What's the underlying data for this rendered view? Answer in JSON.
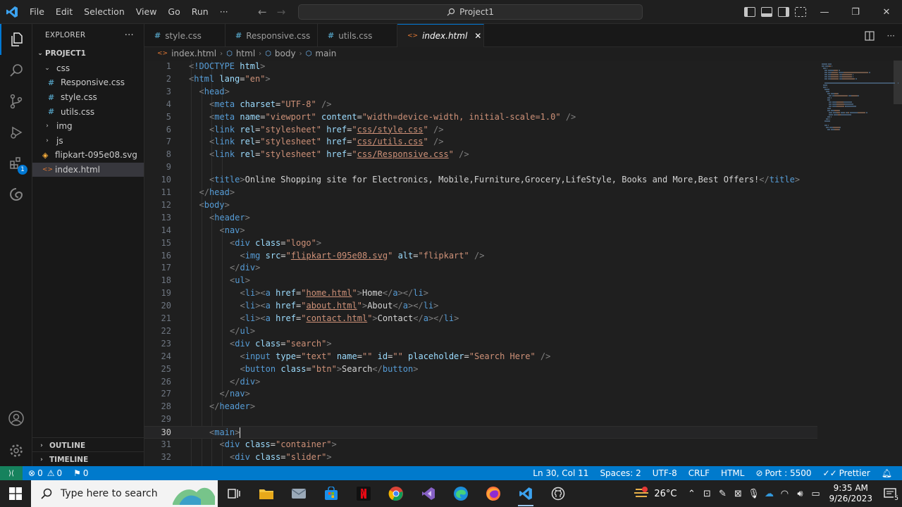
{
  "menu": [
    "File",
    "Edit",
    "Selection",
    "View",
    "Go",
    "Run",
    "···"
  ],
  "command_center": "Project1",
  "window_controls": {
    "minimize": "—",
    "restore": "❐",
    "close": "✕"
  },
  "explorer": {
    "title": "EXPLORER",
    "more": "···",
    "project": "PROJECT1",
    "tree": [
      {
        "label": "css",
        "kind": "folder-open",
        "depth": 1
      },
      {
        "label": "Responsive.css",
        "kind": "css",
        "depth": 2
      },
      {
        "label": "style.css",
        "kind": "css",
        "depth": 2
      },
      {
        "label": "utils.css",
        "kind": "css",
        "depth": 2
      },
      {
        "label": "img",
        "kind": "folder",
        "depth": 1
      },
      {
        "label": "js",
        "kind": "folder",
        "depth": 1
      },
      {
        "label": "flipkart-095e08.svg",
        "kind": "svg",
        "depth": 1
      },
      {
        "label": "index.html",
        "kind": "html",
        "depth": 1,
        "selected": true
      }
    ],
    "outline": "OUTLINE",
    "timeline": "TIMELINE"
  },
  "extensions_badge": "1",
  "tabs": [
    {
      "label": "style.css",
      "icon": "#"
    },
    {
      "label": "Responsive.css",
      "icon": "#"
    },
    {
      "label": "utils.css",
      "icon": "#"
    },
    {
      "label": "index.html",
      "icon": "<>",
      "active": true,
      "close": "✕"
    }
  ],
  "breadcrumb": [
    "index.html",
    "html",
    "body",
    "main"
  ],
  "code": [
    {
      "n": "1",
      "i": 0,
      "tokens": [
        [
          "ang",
          "<"
        ],
        [
          "tag",
          "!DOCTYPE"
        ],
        [
          "txt",
          " "
        ],
        [
          "attr",
          "html"
        ],
        [
          "ang",
          ">"
        ]
      ]
    },
    {
      "n": "2",
      "i": 0,
      "tokens": [
        [
          "ang",
          "<"
        ],
        [
          "tag",
          "html"
        ],
        [
          "txt",
          " "
        ],
        [
          "attr",
          "lang"
        ],
        [
          "txt",
          "="
        ],
        [
          "str",
          "\"en\""
        ],
        [
          "ang",
          ">"
        ]
      ]
    },
    {
      "n": "3",
      "i": 1,
      "tokens": [
        [
          "ang",
          "<"
        ],
        [
          "tag",
          "head"
        ],
        [
          "ang",
          ">"
        ]
      ]
    },
    {
      "n": "4",
      "i": 2,
      "tokens": [
        [
          "ang",
          "<"
        ],
        [
          "tag",
          "meta"
        ],
        [
          "txt",
          " "
        ],
        [
          "attr",
          "charset"
        ],
        [
          "txt",
          "="
        ],
        [
          "str",
          "\"UTF-8\""
        ],
        [
          "txt",
          " "
        ],
        [
          "ang",
          "/>"
        ]
      ]
    },
    {
      "n": "5",
      "i": 2,
      "tokens": [
        [
          "ang",
          "<"
        ],
        [
          "tag",
          "meta"
        ],
        [
          "txt",
          " "
        ],
        [
          "attr",
          "name"
        ],
        [
          "txt",
          "="
        ],
        [
          "str",
          "\"viewport\""
        ],
        [
          "txt",
          " "
        ],
        [
          "attr",
          "content"
        ],
        [
          "txt",
          "="
        ],
        [
          "str",
          "\"width=device-width, initial-scale=1.0\""
        ],
        [
          "txt",
          " "
        ],
        [
          "ang",
          "/>"
        ]
      ]
    },
    {
      "n": "6",
      "i": 2,
      "tokens": [
        [
          "ang",
          "<"
        ],
        [
          "tag",
          "link"
        ],
        [
          "txt",
          " "
        ],
        [
          "attr",
          "rel"
        ],
        [
          "txt",
          "="
        ],
        [
          "str",
          "\"stylesheet\""
        ],
        [
          "txt",
          " "
        ],
        [
          "attr",
          "href"
        ],
        [
          "txt",
          "="
        ],
        [
          "str",
          "\""
        ],
        [
          "strul",
          "css/style.css"
        ],
        [
          "str",
          "\""
        ],
        [
          "txt",
          " "
        ],
        [
          "ang",
          "/>"
        ]
      ]
    },
    {
      "n": "7",
      "i": 2,
      "tokens": [
        [
          "ang",
          "<"
        ],
        [
          "tag",
          "link"
        ],
        [
          "txt",
          " "
        ],
        [
          "attr",
          "rel"
        ],
        [
          "txt",
          "="
        ],
        [
          "str",
          "\"stylesheet\""
        ],
        [
          "txt",
          " "
        ],
        [
          "attr",
          "href"
        ],
        [
          "txt",
          "="
        ],
        [
          "str",
          "\""
        ],
        [
          "strul",
          "css/utils.css"
        ],
        [
          "str",
          "\""
        ],
        [
          "txt",
          " "
        ],
        [
          "ang",
          "/>"
        ]
      ]
    },
    {
      "n": "8",
      "i": 2,
      "tokens": [
        [
          "ang",
          "<"
        ],
        [
          "tag",
          "link"
        ],
        [
          "txt",
          " "
        ],
        [
          "attr",
          "rel"
        ],
        [
          "txt",
          "="
        ],
        [
          "str",
          "\"stylesheet\""
        ],
        [
          "txt",
          " "
        ],
        [
          "attr",
          "href"
        ],
        [
          "txt",
          "="
        ],
        [
          "str",
          "\""
        ],
        [
          "strul",
          "css/Responsive.css"
        ],
        [
          "str",
          "\""
        ],
        [
          "txt",
          " "
        ],
        [
          "ang",
          "/>"
        ]
      ]
    },
    {
      "n": "9",
      "i": 0,
      "tokens": []
    },
    {
      "n": "10",
      "i": 2,
      "tokens": [
        [
          "ang",
          "<"
        ],
        [
          "tag",
          "title"
        ],
        [
          "ang",
          ">"
        ],
        [
          "txt",
          "Online Shopping site for Electronics, Mobile,Furniture,Grocery,LifeStyle, Books and More,Best Offers!"
        ],
        [
          "ang",
          "</"
        ],
        [
          "tag",
          "title"
        ],
        [
          "ang",
          ">"
        ]
      ]
    },
    {
      "n": "11",
      "i": 1,
      "tokens": [
        [
          "ang",
          "</"
        ],
        [
          "tag",
          "head"
        ],
        [
          "ang",
          ">"
        ]
      ]
    },
    {
      "n": "12",
      "i": 1,
      "tokens": [
        [
          "ang",
          "<"
        ],
        [
          "tag",
          "body"
        ],
        [
          "ang",
          ">"
        ]
      ]
    },
    {
      "n": "13",
      "i": 2,
      "tokens": [
        [
          "ang",
          "<"
        ],
        [
          "tag",
          "header"
        ],
        [
          "ang",
          ">"
        ]
      ]
    },
    {
      "n": "14",
      "i": 3,
      "tokens": [
        [
          "ang",
          "<"
        ],
        [
          "tag",
          "nav"
        ],
        [
          "ang",
          ">"
        ]
      ]
    },
    {
      "n": "15",
      "i": 4,
      "tokens": [
        [
          "ang",
          "<"
        ],
        [
          "tag",
          "div"
        ],
        [
          "txt",
          " "
        ],
        [
          "attr",
          "class"
        ],
        [
          "txt",
          "="
        ],
        [
          "str",
          "\"logo\""
        ],
        [
          "ang",
          ">"
        ]
      ]
    },
    {
      "n": "16",
      "i": 5,
      "tokens": [
        [
          "ang",
          "<"
        ],
        [
          "tag",
          "img"
        ],
        [
          "txt",
          " "
        ],
        [
          "attr",
          "src"
        ],
        [
          "txt",
          "="
        ],
        [
          "str",
          "\""
        ],
        [
          "strul",
          "flipkart-095e08.svg"
        ],
        [
          "str",
          "\""
        ],
        [
          "txt",
          " "
        ],
        [
          "attr",
          "alt"
        ],
        [
          "txt",
          "="
        ],
        [
          "str",
          "\"flipkart\""
        ],
        [
          "txt",
          " "
        ],
        [
          "ang",
          "/>"
        ]
      ]
    },
    {
      "n": "17",
      "i": 4,
      "tokens": [
        [
          "ang",
          "</"
        ],
        [
          "tag",
          "div"
        ],
        [
          "ang",
          ">"
        ]
      ]
    },
    {
      "n": "18",
      "i": 4,
      "tokens": [
        [
          "ang",
          "<"
        ],
        [
          "tag",
          "ul"
        ],
        [
          "ang",
          ">"
        ]
      ]
    },
    {
      "n": "19",
      "i": 5,
      "tokens": [
        [
          "ang",
          "<"
        ],
        [
          "tag",
          "li"
        ],
        [
          "ang",
          "><"
        ],
        [
          "tag",
          "a"
        ],
        [
          "txt",
          " "
        ],
        [
          "attr",
          "href"
        ],
        [
          "txt",
          "="
        ],
        [
          "str",
          "\""
        ],
        [
          "strul",
          "home.html"
        ],
        [
          "str",
          "\""
        ],
        [
          "ang",
          ">"
        ],
        [
          "txt",
          "Home"
        ],
        [
          "ang",
          "</"
        ],
        [
          "tag",
          "a"
        ],
        [
          "ang",
          "></"
        ],
        [
          "tag",
          "li"
        ],
        [
          "ang",
          ">"
        ]
      ]
    },
    {
      "n": "20",
      "i": 5,
      "tokens": [
        [
          "ang",
          "<"
        ],
        [
          "tag",
          "li"
        ],
        [
          "ang",
          "><"
        ],
        [
          "tag",
          "a"
        ],
        [
          "txt",
          " "
        ],
        [
          "attr",
          "href"
        ],
        [
          "txt",
          "="
        ],
        [
          "str",
          "\""
        ],
        [
          "strul",
          "about.html"
        ],
        [
          "str",
          "\""
        ],
        [
          "ang",
          ">"
        ],
        [
          "txt",
          "About"
        ],
        [
          "ang",
          "</"
        ],
        [
          "tag",
          "a"
        ],
        [
          "ang",
          "></"
        ],
        [
          "tag",
          "li"
        ],
        [
          "ang",
          ">"
        ]
      ]
    },
    {
      "n": "21",
      "i": 5,
      "tokens": [
        [
          "ang",
          "<"
        ],
        [
          "tag",
          "li"
        ],
        [
          "ang",
          "><"
        ],
        [
          "tag",
          "a"
        ],
        [
          "txt",
          " "
        ],
        [
          "attr",
          "href"
        ],
        [
          "txt",
          "="
        ],
        [
          "str",
          "\""
        ],
        [
          "strul",
          "contact.html"
        ],
        [
          "str",
          "\""
        ],
        [
          "ang",
          ">"
        ],
        [
          "txt",
          "Contact"
        ],
        [
          "ang",
          "</"
        ],
        [
          "tag",
          "a"
        ],
        [
          "ang",
          "></"
        ],
        [
          "tag",
          "li"
        ],
        [
          "ang",
          ">"
        ]
      ]
    },
    {
      "n": "22",
      "i": 4,
      "tokens": [
        [
          "ang",
          "</"
        ],
        [
          "tag",
          "ul"
        ],
        [
          "ang",
          ">"
        ]
      ]
    },
    {
      "n": "23",
      "i": 4,
      "tokens": [
        [
          "ang",
          "<"
        ],
        [
          "tag",
          "div"
        ],
        [
          "txt",
          " "
        ],
        [
          "attr",
          "class"
        ],
        [
          "txt",
          "="
        ],
        [
          "str",
          "\"search\""
        ],
        [
          "ang",
          ">"
        ]
      ]
    },
    {
      "n": "24",
      "i": 5,
      "tokens": [
        [
          "ang",
          "<"
        ],
        [
          "tag",
          "input"
        ],
        [
          "txt",
          " "
        ],
        [
          "attr",
          "type"
        ],
        [
          "txt",
          "="
        ],
        [
          "str",
          "\"text\""
        ],
        [
          "txt",
          " "
        ],
        [
          "attr",
          "name"
        ],
        [
          "txt",
          "="
        ],
        [
          "str",
          "\"\""
        ],
        [
          "txt",
          " "
        ],
        [
          "attr",
          "id"
        ],
        [
          "txt",
          "="
        ],
        [
          "str",
          "\"\""
        ],
        [
          "txt",
          " "
        ],
        [
          "attr",
          "placeholder"
        ],
        [
          "txt",
          "="
        ],
        [
          "str",
          "\"Search Here\""
        ],
        [
          "txt",
          " "
        ],
        [
          "ang",
          "/>"
        ]
      ]
    },
    {
      "n": "25",
      "i": 5,
      "tokens": [
        [
          "ang",
          "<"
        ],
        [
          "tag",
          "button"
        ],
        [
          "txt",
          " "
        ],
        [
          "attr",
          "class"
        ],
        [
          "txt",
          "="
        ],
        [
          "str",
          "\"btn\""
        ],
        [
          "ang",
          ">"
        ],
        [
          "txt",
          "Search"
        ],
        [
          "ang",
          "</"
        ],
        [
          "tag",
          "button"
        ],
        [
          "ang",
          ">"
        ]
      ]
    },
    {
      "n": "26",
      "i": 4,
      "tokens": [
        [
          "ang",
          "</"
        ],
        [
          "tag",
          "div"
        ],
        [
          "ang",
          ">"
        ]
      ]
    },
    {
      "n": "27",
      "i": 3,
      "tokens": [
        [
          "ang",
          "</"
        ],
        [
          "tag",
          "nav"
        ],
        [
          "ang",
          ">"
        ]
      ]
    },
    {
      "n": "28",
      "i": 2,
      "tokens": [
        [
          "ang",
          "</"
        ],
        [
          "tag",
          "header"
        ],
        [
          "ang",
          ">"
        ]
      ]
    },
    {
      "n": "29",
      "i": 0,
      "tokens": []
    },
    {
      "n": "30",
      "i": 2,
      "current": true,
      "tokens": [
        [
          "ang",
          "<"
        ],
        [
          "tag",
          "main"
        ],
        [
          "ang",
          ">"
        ]
      ]
    },
    {
      "n": "31",
      "i": 3,
      "tokens": [
        [
          "ang",
          "<"
        ],
        [
          "tag",
          "div"
        ],
        [
          "txt",
          " "
        ],
        [
          "attr",
          "class"
        ],
        [
          "txt",
          "="
        ],
        [
          "str",
          "\"container\""
        ],
        [
          "ang",
          ">"
        ]
      ]
    },
    {
      "n": "32",
      "i": 4,
      "tokens": [
        [
          "ang",
          "<"
        ],
        [
          "tag",
          "div"
        ],
        [
          "txt",
          " "
        ],
        [
          "attr",
          "class"
        ],
        [
          "txt",
          "="
        ],
        [
          "str",
          "\"slider\""
        ],
        [
          "ang",
          ">"
        ]
      ]
    }
  ],
  "statusbar": {
    "remote": "⟩⟨",
    "errors": "0",
    "warnings": "0",
    "ports": "0",
    "position": "Ln 30, Col 11",
    "spaces": "Spaces: 2",
    "encoding": "UTF-8",
    "eol": "CRLF",
    "language": "HTML",
    "port": "Port : 5500",
    "prettier": "Prettier"
  },
  "taskbar": {
    "search_placeholder": "Type here to search",
    "weather": "26°C",
    "time": "9:35 AM",
    "date": "9/26/2023",
    "notifications": "5"
  },
  "colors": {
    "accent": "#007acc",
    "remote": "#16825d",
    "tag": "#569cd6",
    "attr": "#9cdcfe",
    "string": "#ce9178"
  }
}
